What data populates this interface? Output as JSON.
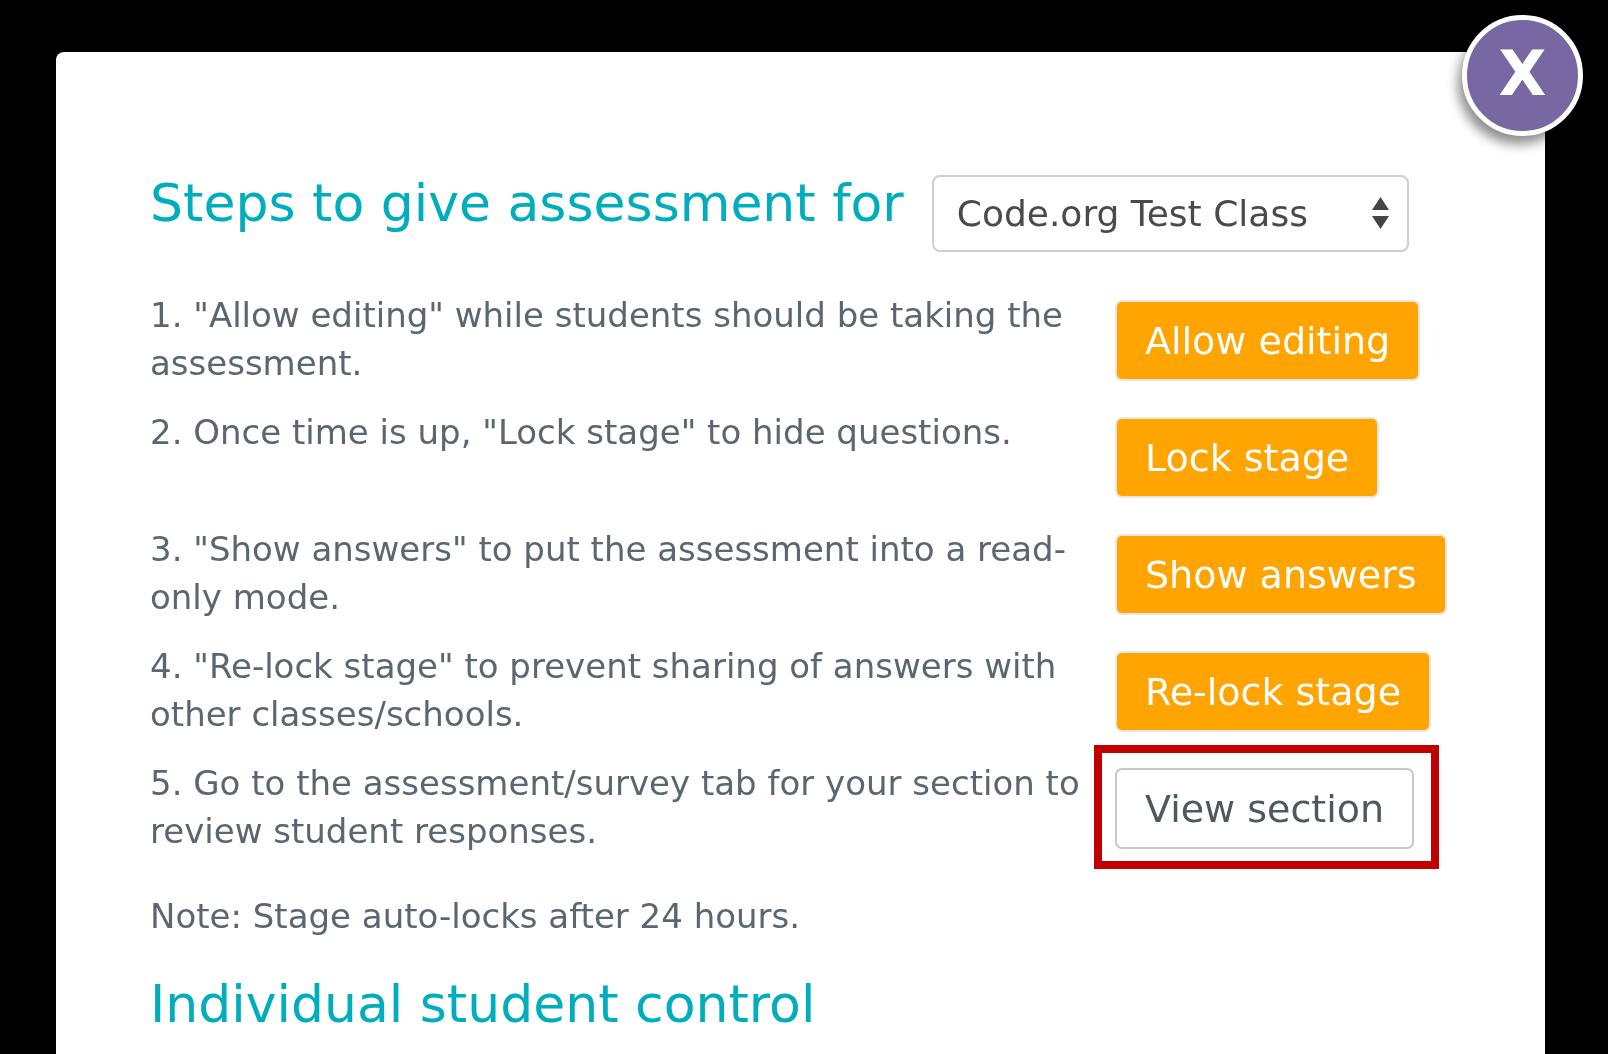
{
  "dialog": {
    "close_button": {
      "label": "X"
    },
    "title": "Steps to give assessment for",
    "section_select": {
      "value": "Code.org Test Class"
    },
    "steps": [
      {
        "text": "1. \"Allow editing\" while students should be taking the assessment.",
        "button": {
          "label": "Allow editing",
          "kind": "primary",
          "highlighted": false
        }
      },
      {
        "text": "2. Once time is up, \"Lock stage\" to hide questions.",
        "button": {
          "label": "Lock stage",
          "kind": "primary",
          "highlighted": false
        }
      },
      {
        "text": "3. \"Show answers\" to put the assessment into a read-only mode.",
        "button": {
          "label": "Show answers",
          "kind": "primary",
          "highlighted": false
        }
      },
      {
        "text": "4. \"Re-lock stage\" to prevent sharing of answers with other classes/schools.",
        "button": {
          "label": "Re-lock stage",
          "kind": "primary",
          "highlighted": false
        }
      },
      {
        "text": "5. Go to the assessment/survey tab for your section to review student responses.",
        "button": {
          "label": "View section",
          "kind": "secondary",
          "highlighted": true
        }
      }
    ],
    "note": "Note: Stage auto-locks after 24 hours.",
    "subheading": "Individual student control"
  }
}
